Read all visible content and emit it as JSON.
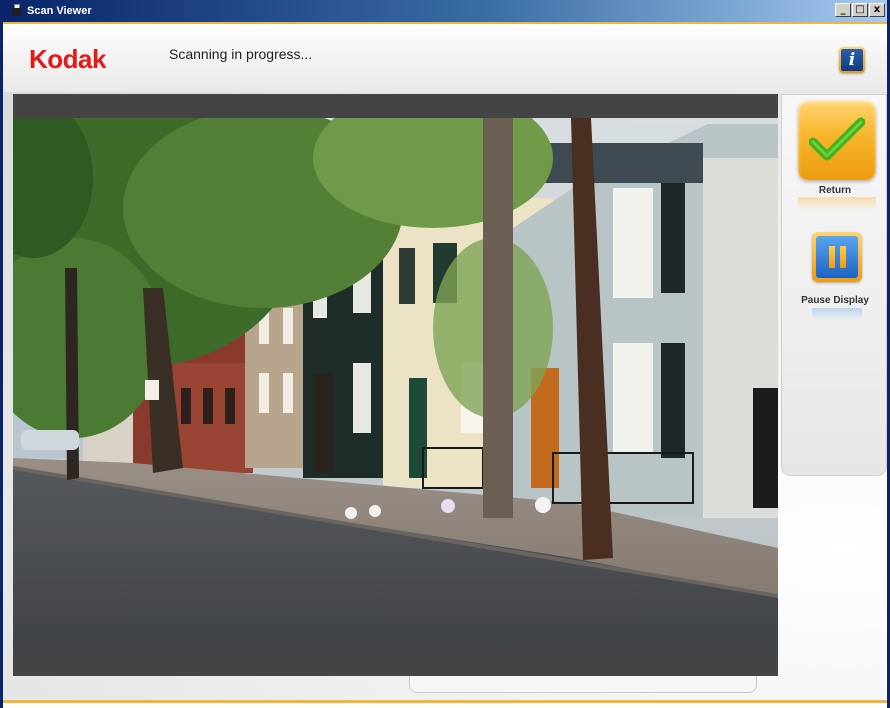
{
  "window": {
    "title": "Scan Viewer",
    "controls": {
      "minimize": "_",
      "maximize": "□",
      "close": "x"
    }
  },
  "header": {
    "brand": "Kodak",
    "status": "Scanning in progress...",
    "info_icon_glyph": "i"
  },
  "side_panel": {
    "return_label": "Return",
    "pause_label": "Pause Display"
  },
  "colors": {
    "brand_red": "#e21a1a",
    "accent_orange": "#f2b43c",
    "button_blue": "#1d62c4",
    "checkmark_green": "#3fb21c"
  },
  "icons": {
    "info": "info-icon",
    "return": "checkmark-icon",
    "pause": "pause-icon"
  }
}
